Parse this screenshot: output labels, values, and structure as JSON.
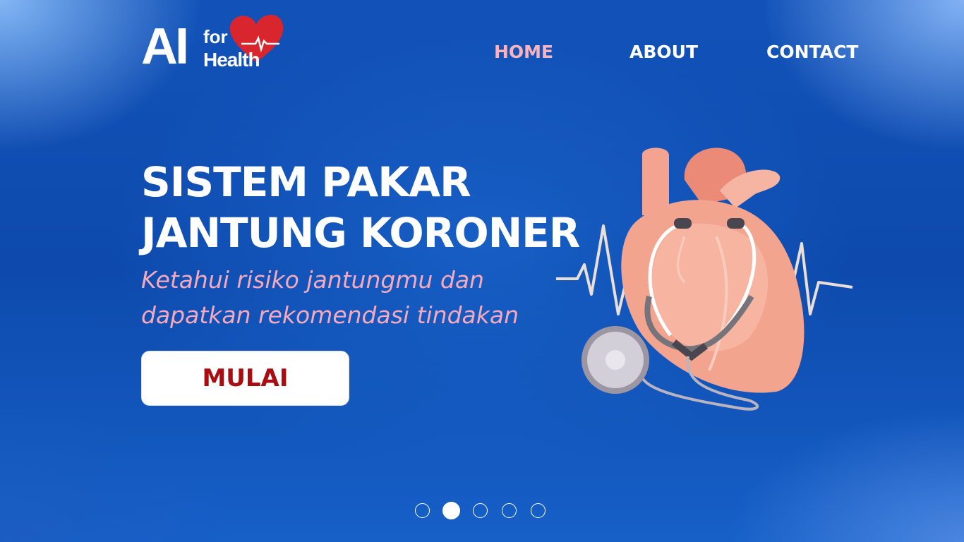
{
  "logo": {
    "main": "AI",
    "small_top": "for",
    "small_bottom": "Health",
    "heart_color": "#d9252e"
  },
  "nav": {
    "items": [
      {
        "label": "HOME",
        "active": true
      },
      {
        "label": "ABOUT",
        "active": false
      },
      {
        "label": "CONTACT",
        "active": false
      }
    ],
    "active_color": "#f7b3be"
  },
  "hero": {
    "title_line1": "SISTEM PAKAR",
    "title_line2": "JANTUNG KORONER",
    "subtitle_line1": "Ketahui risiko jantungmu dan",
    "subtitle_line2": "dapatkan rekomendasi tindakan",
    "cta_label": "MULAI",
    "cta_text_color": "#a80d12"
  },
  "carousel": {
    "slide_count": 5,
    "active_slide": 2
  },
  "illustration": {
    "icons": [
      "heart-illustration",
      "stethoscope-icon",
      "ecg-line"
    ]
  }
}
